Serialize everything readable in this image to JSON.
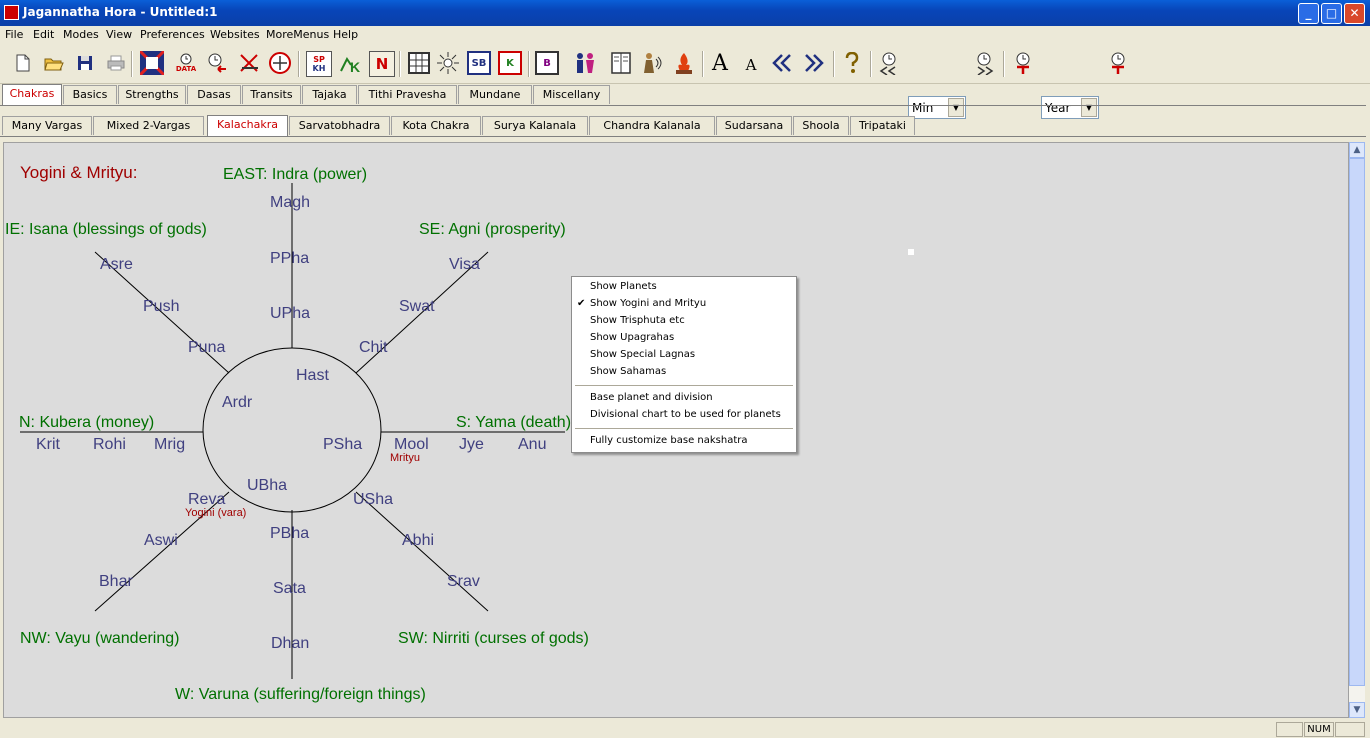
{
  "window": {
    "title": "Jagannatha Hora - Untitled:1"
  },
  "menu": [
    "File",
    "Edit",
    "Modes",
    "View",
    "Preferences",
    "Websites",
    "MoreMenus",
    "Help"
  ],
  "toolbar": {
    "unit_select": "Min",
    "period_select": "Year",
    "icons": [
      "new-file",
      "open-folder",
      "save-disk",
      "print",
      "chart-logo",
      "data-clock",
      "clock-back",
      "scissors-arrow",
      "clock-circle",
      "sp-kh",
      "k-figure",
      "n-letter",
      "grid-table",
      "sun-burst",
      "sb-box",
      "k-box",
      "b-grid",
      "people",
      "book",
      "speaker-figure",
      "fire-lamp",
      "font-large",
      "font-small",
      "double-left",
      "double-right",
      "help-key",
      "clock-rewind",
      "clock-forward",
      "time-back",
      "time-forward"
    ],
    "labels": {
      "sp": "SP",
      "kh": "KH",
      "n": "N",
      "sb": "SB",
      "k": "K",
      "b": "B",
      "a_big": "A",
      "a_small": "A",
      "data": "DATA"
    }
  },
  "tabs_main": [
    "Chakras",
    "Basics",
    "Strengths",
    "Dasas",
    "Transits",
    "Tajaka",
    "Tithi Pravesha",
    "Mundane",
    "Miscellany"
  ],
  "tabs_main_active": "Chakras",
  "tabs_sub": [
    "Many Vargas",
    "Mixed 2-Vargas",
    "Kalachakra",
    "Sarvatobhadra",
    "Kota Chakra",
    "Surya Kalanala",
    "Chandra Kalanala",
    "Sudarsana",
    "Shoola",
    "Tripataki"
  ],
  "tabs_sub_active": "Kalachakra",
  "chakra": {
    "heading": "Yogini & Mrityu:",
    "directions": {
      "east": "EAST: Indra (power)",
      "northeast": "IE: Isana (blessings of gods)",
      "southeast": "SE: Agni (prosperity)",
      "north": "N: Kubera (money)",
      "south": "S: Yama (death)",
      "northwest": "NW: Vayu (wandering)",
      "southwest": "SW: Nirriti (curses of gods)",
      "west": "W: Varuna (suffering/foreign things)"
    },
    "nakshatras": {
      "magh": "Magh",
      "ppha": "PPha",
      "upha": "UPha",
      "hast": "Hast",
      "asre": "Asre",
      "push": "Push",
      "puna": "Puna",
      "ardr": "Ardr",
      "visa": "Visa",
      "swat": "Swat",
      "chit": "Chit",
      "krit": "Krit",
      "rohi": "Rohi",
      "mrig": "Mrig",
      "psha": "PSha",
      "mool": "Mool",
      "jye": "Jye",
      "anu": "Anu",
      "reva": "Reva",
      "ubha": "UBha",
      "aswi": "Aswi",
      "bhar": "Bhar",
      "pbha": "PBha",
      "sata": "Sata",
      "dhan": "Dhan",
      "usha": "USha",
      "abhi": "Abhi",
      "srav": "Srav"
    },
    "markers": {
      "mrityu": "Mrityu",
      "yogini": "Yogini (vara)"
    }
  },
  "context_menu": {
    "items": [
      {
        "label": "Show Planets",
        "checked": false
      },
      {
        "label": "Show Yogini and Mrityu",
        "checked": true
      },
      {
        "label": "Show Trisphuta etc",
        "checked": false
      },
      {
        "label": "Show Upagrahas",
        "checked": false
      },
      {
        "label": "Show Special Lagnas",
        "checked": false
      },
      {
        "label": "Show Sahamas",
        "checked": false
      }
    ],
    "items2": [
      "Base planet and division",
      "Divisional chart to be used for planets"
    ],
    "items3": [
      "Fully customize base nakshatra"
    ],
    "check_mark": "✔"
  },
  "status": {
    "num": "NUM"
  },
  "colors": {
    "direction_green": "#007000",
    "nakshatra_blue": "#404080",
    "heading_red": "#a00000",
    "marker_red": "#a00000"
  }
}
